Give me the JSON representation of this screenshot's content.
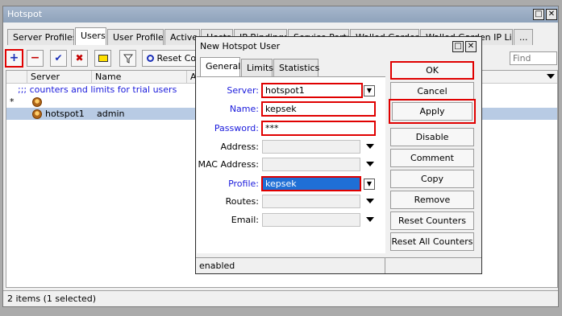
{
  "main_window": {
    "title": "Hotspot",
    "minimize_glyph": "□",
    "close_glyph": "✕",
    "tabs": [
      {
        "label": "Server Profiles",
        "active": false
      },
      {
        "label": "Users",
        "active": true
      },
      {
        "label": "User Profiles",
        "active": false
      },
      {
        "label": "Active",
        "active": false
      },
      {
        "label": "Hosts",
        "active": false
      },
      {
        "label": "IP Bindings",
        "active": false
      },
      {
        "label": "Service Ports",
        "active": false
      },
      {
        "label": "Walled Garden",
        "active": false
      },
      {
        "label": "Walled Garden IP List",
        "active": false
      },
      {
        "label": "...",
        "active": false
      }
    ],
    "toolbar": {
      "add_glyph": "+",
      "remove_glyph": "−",
      "enable_glyph": "✔",
      "disable_glyph": "✖",
      "reset_label": "Reset Co",
      "find_placeholder": "Find"
    },
    "columns": [
      "Server",
      "Name",
      "Ad"
    ],
    "comment_row": ";;; counters and limits for trial users",
    "rows": [
      {
        "flag": "*",
        "server": "",
        "name": ""
      },
      {
        "flag": "",
        "server": "hotspot1",
        "name": "admin"
      }
    ],
    "status_text": "2 items (1 selected)"
  },
  "dialog": {
    "title": "New Hotspot User",
    "tabs": [
      {
        "label": "General",
        "active": true
      },
      {
        "label": "Limits",
        "active": false
      },
      {
        "label": "Statistics",
        "active": false
      }
    ],
    "fields": {
      "server": {
        "label": "Server:",
        "value": "hotspot1"
      },
      "name": {
        "label": "Name:",
        "value": "kepsek"
      },
      "password": {
        "label": "Password:",
        "value": "***"
      },
      "address": {
        "label": "Address:",
        "value": ""
      },
      "mac": {
        "label": "MAC Address:",
        "value": ""
      },
      "profile": {
        "label": "Profile:",
        "value": "kepsek"
      },
      "routes": {
        "label": "Routes:",
        "value": ""
      },
      "email": {
        "label": "Email:",
        "value": ""
      }
    },
    "buttons": {
      "ok": "OK",
      "cancel": "Cancel",
      "apply": "Apply",
      "disable": "Disable",
      "comment": "Comment",
      "copy": "Copy",
      "remove": "Remove",
      "reset_counters": "Reset Counters",
      "reset_all_counters": "Reset All Counters"
    },
    "status_text": "enabled"
  },
  "colors": {
    "highlight_outline": "#e00000",
    "field_label_blue": "#1a1adc",
    "selection_blue": "#1f6fd6",
    "title_bar": "#8fa3bb"
  }
}
